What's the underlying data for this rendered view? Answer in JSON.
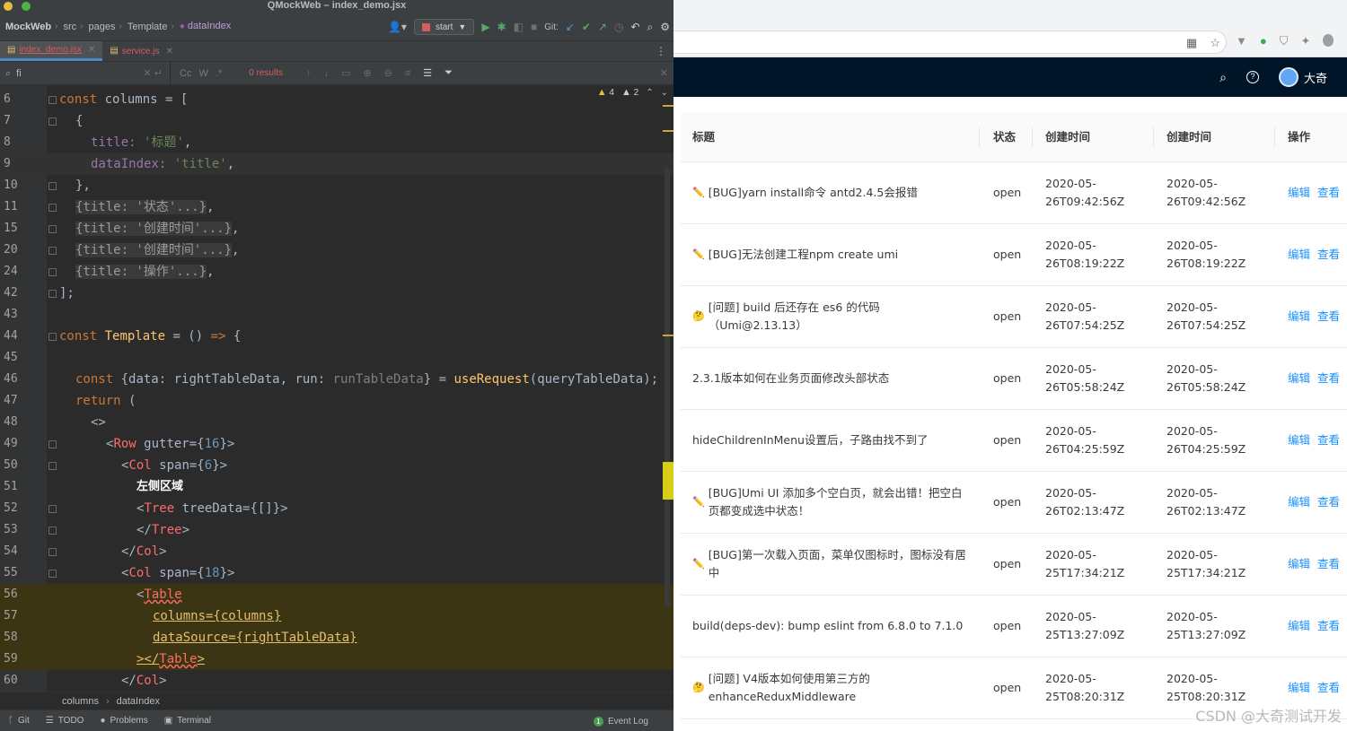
{
  "ide": {
    "title": "QMockWeb – index_demo.jsx",
    "breadcrumbs": [
      "MockWeb",
      "src",
      "pages",
      "Template",
      "dataIndex"
    ],
    "run_config": "start",
    "git_label": "Git:",
    "tabs": [
      {
        "label": "index_demo.jsx",
        "active": true
      },
      {
        "label": "service.js",
        "active": false
      }
    ],
    "find": {
      "query": "fi",
      "results": "0 results",
      "case_label": "Cc",
      "word_label": "W",
      "regex_label": ".*"
    },
    "inspection": {
      "warnings": "4",
      "weak_warnings": "2"
    },
    "lines": [
      {
        "n": "6"
      },
      {
        "n": "7"
      },
      {
        "n": "8"
      },
      {
        "n": "9"
      },
      {
        "n": "10"
      },
      {
        "n": "11"
      },
      {
        "n": "15"
      },
      {
        "n": "20"
      },
      {
        "n": "24"
      },
      {
        "n": "42"
      },
      {
        "n": "43"
      },
      {
        "n": "44"
      },
      {
        "n": "45"
      },
      {
        "n": "46"
      },
      {
        "n": "47"
      },
      {
        "n": "48"
      },
      {
        "n": "49"
      },
      {
        "n": "50"
      },
      {
        "n": "51"
      },
      {
        "n": "52"
      },
      {
        "n": "53"
      },
      {
        "n": "54"
      },
      {
        "n": "55"
      },
      {
        "n": "56"
      },
      {
        "n": "57"
      },
      {
        "n": "58"
      },
      {
        "n": "59"
      },
      {
        "n": "60"
      }
    ],
    "code": {
      "c6": [
        "const",
        " columns = ["
      ],
      "c7": "{",
      "c8": [
        "title: ",
        "'标题'",
        ","
      ],
      "c9": [
        "dataIndex: ",
        "'title'",
        ","
      ],
      "c10": "},",
      "c11": "{title: '状态'...}",
      "c15": "{title: '创建时间'...}",
      "c20": "{title: '创建时间'...}",
      "c24": "{title: '操作'...}",
      "c42": "];",
      "c44": [
        "const",
        " Template",
        " = () ",
        "=>",
        " {"
      ],
      "c46": [
        "const",
        " {data: rightTableData, run: ",
        "runTableData",
        "} = ",
        "useRequest",
        "(queryTableData);"
      ],
      "c47": [
        "return",
        " ("
      ],
      "c48": "<>",
      "c49": [
        "<",
        "Row",
        " gutter={",
        "16",
        "}>"
      ],
      "c50": [
        "<",
        "Col",
        " span={",
        "6",
        "}>"
      ],
      "c51": "左侧区域",
      "c52": [
        "<",
        "Tree",
        " treeData={[]}>"
      ],
      "c53": [
        "</",
        "Tree",
        ">"
      ],
      "c54": [
        "</",
        "Col",
        ">"
      ],
      "c55": [
        "<",
        "Col",
        " span={",
        "18",
        "}>"
      ],
      "c56": [
        "<",
        "Table"
      ],
      "c57": "columns={columns}",
      "c58": "dataSource={rightTableData}",
      "c59": [
        "></",
        "Table",
        ">"
      ],
      "c60": [
        "</",
        "Col",
        ">"
      ]
    },
    "path_breadcrumbs": [
      "columns",
      "dataIndex"
    ],
    "status": {
      "git": "Git",
      "todo": "TODO",
      "problems": "Problems",
      "terminal": "Terminal",
      "event_log": "Event Log",
      "event_count": "1"
    }
  },
  "browser": {
    "header": {
      "user_name": "大奇"
    },
    "table": {
      "columns": [
        "标题",
        "状态",
        "创建时间",
        "创建时间",
        "操作"
      ],
      "rows": [
        {
          "icon": "✏️",
          "title": "[BUG]yarn install命令 antd2.4.5会报错",
          "state": "open",
          "created_a": "2020-05-26T09:42:56Z",
          "created_b": "2020-05-26T09:42:56Z"
        },
        {
          "icon": "✏️",
          "title": "[BUG]无法创建工程npm create umi",
          "state": "open",
          "created_a": "2020-05-26T08:19:22Z",
          "created_b": "2020-05-26T08:19:22Z"
        },
        {
          "icon": "🤔",
          "title": "[问题] build 后还存在 es6 的代码（Umi@2.13.13）",
          "state": "open",
          "created_a": "2020-05-26T07:54:25Z",
          "created_b": "2020-05-26T07:54:25Z"
        },
        {
          "icon": "",
          "title": "2.3.1版本如何在业务页面修改头部状态",
          "state": "open",
          "created_a": "2020-05-26T05:58:24Z",
          "created_b": "2020-05-26T05:58:24Z"
        },
        {
          "icon": "",
          "title": "hideChildrenInMenu设置后，子路由找不到了",
          "state": "open",
          "created_a": "2020-05-26T04:25:59Z",
          "created_b": "2020-05-26T04:25:59Z"
        },
        {
          "icon": "✏️",
          "title": "[BUG]Umi UI 添加多个空白页，就会出错！把空白页都变成选中状态！",
          "state": "open",
          "created_a": "2020-05-26T02:13:47Z",
          "created_b": "2020-05-26T02:13:47Z"
        },
        {
          "icon": "✏️",
          "title": "[BUG]第一次载入页面，菜单仅图标时，图标没有居中",
          "state": "open",
          "created_a": "2020-05-25T17:34:21Z",
          "created_b": "2020-05-25T17:34:21Z"
        },
        {
          "icon": "",
          "title": "build(deps-dev): bump eslint from 6.8.0 to 7.1.0",
          "state": "open",
          "created_a": "2020-05-25T13:27:09Z",
          "created_b": "2020-05-25T13:27:09Z"
        },
        {
          "icon": "🤔",
          "title": "[问题] V4版本如何使用第三方的enhanceReduxMiddleware",
          "state": "open",
          "created_a": "2020-05-25T08:20:31Z",
          "created_b": "2020-05-25T08:20:31Z"
        }
      ],
      "edit_label": "编辑",
      "view_label": "查看"
    },
    "watermark": "CSDN @大奇测试开发"
  },
  "colors": {
    "ide_bg": "#2b2b2b",
    "header_bg": "#011528",
    "link": "#1890ff",
    "keyword": "#cc7832",
    "string": "#6a8759",
    "tag": "#e8bf6a",
    "number": "#6897bb"
  }
}
